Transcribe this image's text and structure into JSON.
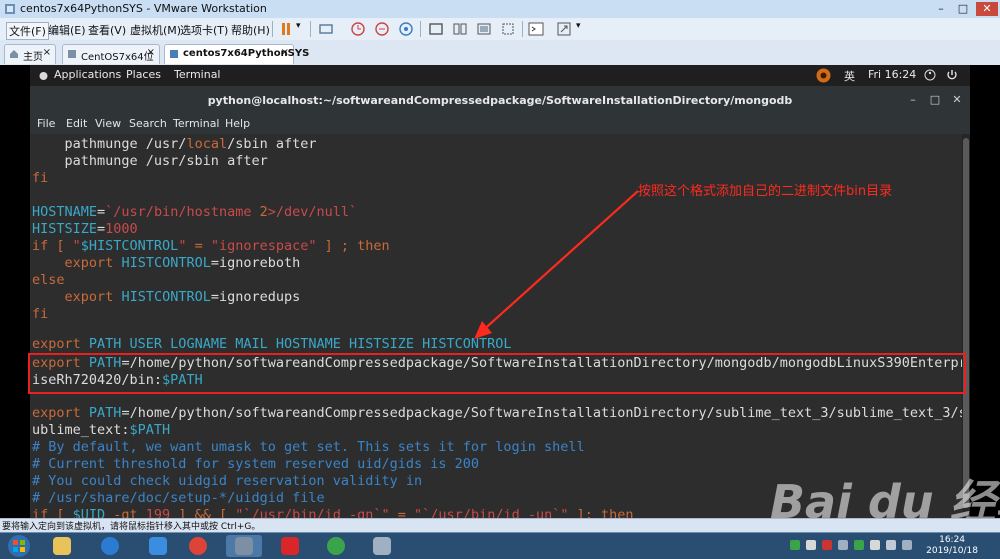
{
  "vmware": {
    "window_title": "centos7x64PythonSYS - VMware Workstation",
    "menu": [
      "文件(F)",
      "编辑(E)",
      "查看(V)",
      "虚拟机(M)",
      "选项卡(T)",
      "帮助(H)"
    ],
    "tabs": [
      {
        "label": "主页",
        "active": false
      },
      {
        "label": "CentOS7x64位",
        "active": false
      },
      {
        "label": "centos7x64PythonSYS",
        "active": true
      }
    ],
    "status_message": "要将输入定向到该虚拟机，请将鼠标指针移入其中或按 Ctrl+G。"
  },
  "gnome": {
    "applications": "Applications",
    "places": "Places",
    "terminal": "Terminal",
    "ime": "英",
    "clock": "Fri 16:24"
  },
  "terminal": {
    "title": "python@localhost:~/softwareandCompressedpackage/SoftwareInstallationDirectory/mongodb",
    "menu": [
      "File",
      "Edit",
      "View",
      "Search",
      "Terminal",
      "Help"
    ]
  },
  "annotation": "按照这个格式添加自己的二进制文件bin目录",
  "watermark": "Bai du 经验",
  "taskbar": {
    "time": "16:24",
    "date": "2019/10/18"
  },
  "colors": {
    "keyword": "#c96a3a",
    "variable": "#3aa8c9",
    "string": "#c94a4a",
    "comment": "#3a84c9",
    "highlight_box": "#e8201f"
  }
}
